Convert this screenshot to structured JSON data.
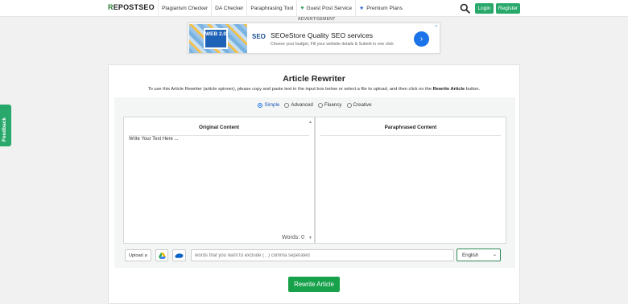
{
  "nav": {
    "logo_r": "R",
    "logo_rest": "EPOSTSEO",
    "items": [
      {
        "label": "Plagiarism Checker",
        "icon": ""
      },
      {
        "label": "DA Checker",
        "icon": ""
      },
      {
        "label": "Paraphrasing Tool",
        "icon": ""
      },
      {
        "label": "Guest Post Service",
        "icon": "heart-icon"
      },
      {
        "label": "Premium Plans",
        "icon": "star-icon"
      }
    ],
    "login": "Login",
    "register": "Register"
  },
  "ad": {
    "label": "ADVERTISEMENT",
    "image_text": "WEB 2.0",
    "brand": "SEO",
    "title": "SEOeStore Quality SEO services",
    "subtitle": "Choose your budget, Fill your website details & Submit in one click"
  },
  "feedback": "Feedback",
  "card": {
    "title": "Article Rewriter",
    "desc_before": "To use this Article Rewriter (article spinner), please copy and paste text in the input box below or select a file to upload, and then click on the ",
    "desc_bold": "Rewrite Article",
    "desc_after": " button."
  },
  "modes": [
    {
      "label": "Simple",
      "selected": true
    },
    {
      "label": "Advanced",
      "selected": false
    },
    {
      "label": "Fluency",
      "selected": false
    },
    {
      "label": "Creative",
      "selected": false
    }
  ],
  "original": {
    "header": "Original Content",
    "placeholder": "Write Your Text Here ...",
    "words": "Words: 0"
  },
  "paraphrased": {
    "header": "Paraphrased Content"
  },
  "toolbar": {
    "upload": "Upload",
    "exclude_placeholder": "words that you want to exclude ( , ) comma seperated",
    "language": "English"
  },
  "rewrite_button": "Rewrite Article",
  "colors": {
    "accent_green": "#28a96b",
    "button_green": "#17a14a",
    "link_blue": "#1a73e8"
  }
}
